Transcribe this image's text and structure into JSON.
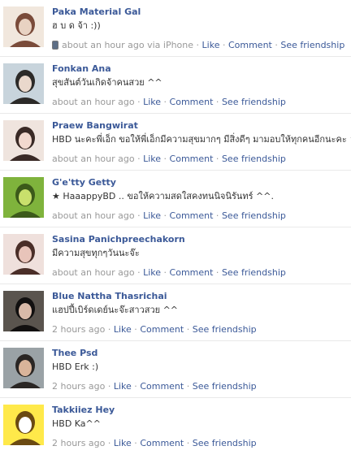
{
  "posts": [
    {
      "name": "Paka Material Gal",
      "message": "ฮ บ ด จ้า :))",
      "time": "about an hour ago",
      "via": "via iPhone",
      "has_phone": true,
      "actions": {
        "like": "Like",
        "comment": "Comment",
        "friendship": "See friendship"
      },
      "avatar": {
        "bg": "#f1e7dd",
        "fg": "#7a4b3a",
        "accent": "#e8d2c2"
      }
    },
    {
      "name": "Fonkan Ana",
      "message": "สุขสันต์วันเกิดจ้าคนสวย ^^",
      "time": "about an hour ago",
      "actions": {
        "like": "Like",
        "comment": "Comment",
        "friendship": "See friendship"
      },
      "avatar": {
        "bg": "#c8d4dc",
        "fg": "#2c2a28",
        "accent": "#ead8cc"
      }
    },
    {
      "name": "Praew Bangwirat",
      "message": "HBD นะคะพี่เอ็ก ขอให้พี่เอ็กมีความสุขมากๆ มีสิ่งดีๆ มามอบให้ทุกคนอีกนะคะ ^^",
      "time": "about an hour ago",
      "actions": {
        "like": "Like",
        "comment": "Comment",
        "friendship": "See friendship"
      },
      "avatar": {
        "bg": "#efe4de",
        "fg": "#3a2a26",
        "accent": "#f2d9cf"
      }
    },
    {
      "name": "G'e'tty Getty",
      "message": "★ HaaappyBD .. ขอให้ความสดใสคงทนนิจนิรันทร์ ^^.",
      "time": "about an hour ago",
      "actions": {
        "like": "Like",
        "comment": "Comment",
        "friendship": "See friendship"
      },
      "avatar": {
        "bg": "#7fb33c",
        "fg": "#3c5a1a",
        "accent": "#c9e06c"
      }
    },
    {
      "name": "Sasina Panichpreechakorn",
      "message": "มีความสุขทุกๆวันนะจ๊ะ",
      "time": "about an hour ago",
      "actions": {
        "like": "Like",
        "comment": "Comment",
        "friendship": "See friendship"
      },
      "avatar": {
        "bg": "#efe0dc",
        "fg": "#4a2e28",
        "accent": "#e8c4ba"
      }
    },
    {
      "name": "Blue Nattha Thasrichai",
      "message": "แฮปปี้เบิร์ดเดย์นะจ๊ะสาวสวย ^^",
      "time": "2 hours ago",
      "actions": {
        "like": "Like",
        "comment": "Comment",
        "friendship": "See friendship"
      },
      "avatar": {
        "bg": "#5a544e",
        "fg": "#121010",
        "accent": "#d8b9a8"
      }
    },
    {
      "name": "Thee Psd",
      "message": "HBD Erk :)",
      "time": "2 hours ago",
      "actions": {
        "like": "Like",
        "comment": "Comment",
        "friendship": "See friendship"
      },
      "avatar": {
        "bg": "#9aa2a6",
        "fg": "#2a2624",
        "accent": "#d9b49a"
      }
    },
    {
      "name": "Takkiiez Hey",
      "message": "HBD Ka^^",
      "time": "2 hours ago",
      "actions": {
        "like": "Like",
        "comment": "Comment",
        "friendship": "See friendship"
      },
      "avatar": {
        "bg": "#ffe94a",
        "fg": "#6b4a12",
        "accent": "#ffffff"
      }
    }
  ]
}
